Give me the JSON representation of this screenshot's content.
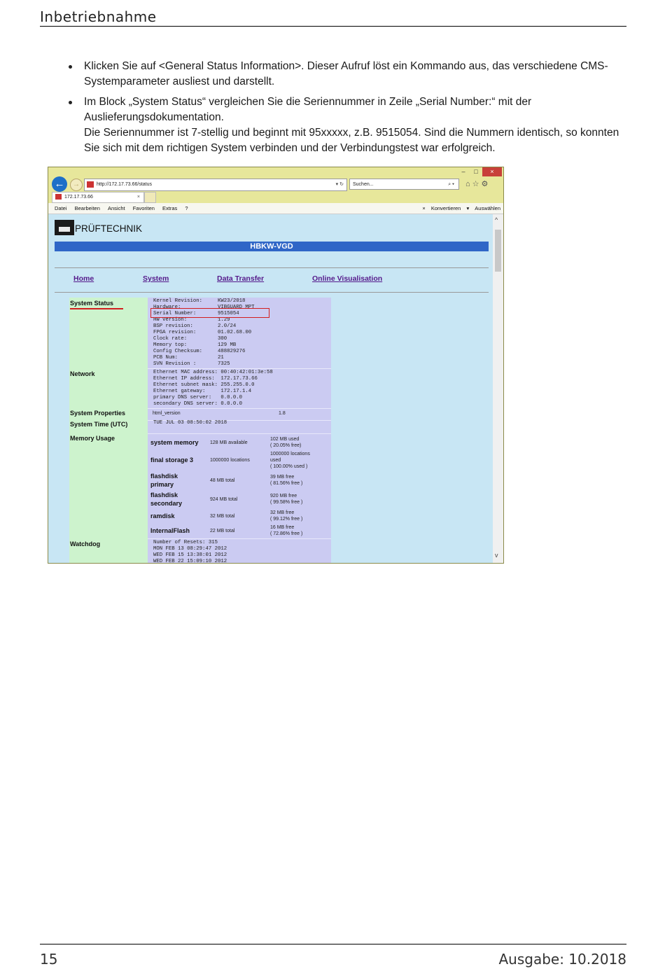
{
  "header": {
    "title": "Inbetriebnahme"
  },
  "bullets": [
    {
      "text": "Klicken Sie auf <General Status Information>. Dieser Aufruf löst ein Kommando aus, das verschiedene CMS-Systemparameter ausliest und darstellt."
    },
    {
      "text": "Im Block „System Status“ vergleichen Sie die Seriennummer in Zeile „Serial Number:“ mit der Auslieferungsdokumentation.",
      "text2": "Die Seriennummer ist 7-stellig und beginnt mit 95xxxxx, z.B. 9515054. Sind die Nummern identisch, so konnten Sie sich mit dem richtigen System verbinden und der Verbindungstest war erfolgreich."
    }
  ],
  "browser": {
    "window_buttons": [
      "–",
      "□",
      "×"
    ],
    "address": "http://172.17.73.66/status",
    "address_controls": "▾ ↻",
    "search_placeholder": "Suchen...",
    "search_icon": "⌕ ▾",
    "toolbar_icons": "⌂☆⚙",
    "tab_label": "172.17.73.66",
    "tab_close": "×",
    "menu": [
      "Datei",
      "Bearbeiten",
      "Ansicht",
      "Favoriten",
      "Extras",
      "?"
    ],
    "menu_right": {
      "close": "×",
      "convert": "Konvertieren",
      "dropdown": "▾",
      "select": "Auswählen"
    }
  },
  "page": {
    "brand": "PRÜFTECHNIK",
    "banner": "HBKW-VGD",
    "nav": [
      "Home",
      "System",
      "Data Transfer",
      "Online Visualisation"
    ],
    "system_status": {
      "label": "System Status",
      "lines": "Kernel Revision:     KW23/2018\nHardware:            VIBGUARD_MPT\nSerial Number:       9515054\nHW version:          1.29\nBSP revision:        2.0/24\nFPGA revision:       01.02.68.00\nClock rate:          300\nMemory top:          129 MB\nConfig Checksum:     488829276\nPCB Num:             21\nSVN Revision :       7325"
    },
    "network": {
      "label": "Network",
      "lines": "Ethernet MAC address: 00:40:42:01:3e:58\nEthernet IP address:  172.17.73.66\nEthernet subnet mask: 255.255.0.0\nEthernet gateway:     172.17.1.4\nprimary DNS server:   0.0.0.0\nsecondary DNS server: 0.0.0.0"
    },
    "system_properties": {
      "label": "System Properties",
      "key": "html_version",
      "value": "1.8"
    },
    "system_time": {
      "label": "System Time (UTC)",
      "value": "TUE JUL 03 08:50:02 2018"
    },
    "memory": {
      "label": "Memory Usage",
      "rows": [
        {
          "name": "system memory",
          "mid": "128 MB available",
          "right": "102 MB used\n( 20.05% free)"
        },
        {
          "name": "final storage 3",
          "mid": "1000000 locations",
          "right": "1000000 locations\nused\n( 100.00% used )"
        },
        {
          "name": "flashdisk\nprimary",
          "mid": "48 MB total",
          "right": "39 MB free\n( 81.56% free )"
        },
        {
          "name": "flashdisk\nsecondary",
          "mid": "924 MB total",
          "right": "920 MB free\n( 99.58% free )"
        },
        {
          "name": "ramdisk",
          "mid": "32 MB total",
          "right": "32 MB free\n( 99.12% free )"
        },
        {
          "name": "InternalFlash",
          "mid": "22 MB total",
          "right": "16 MB free\n( 72.86% free )"
        }
      ]
    },
    "watchdog": {
      "label": "Watchdog",
      "lines": "Number of Resets: 315\nMON FEB 13 08:29:47 2012\nWED FEB 15 13:38:01 2012\nWED FEB 22 15:09:10 2012"
    },
    "scroll": {
      "up": "^",
      "down": "v"
    }
  },
  "footer": {
    "page": "15",
    "edition": "Ausgabe: 10.2018"
  }
}
